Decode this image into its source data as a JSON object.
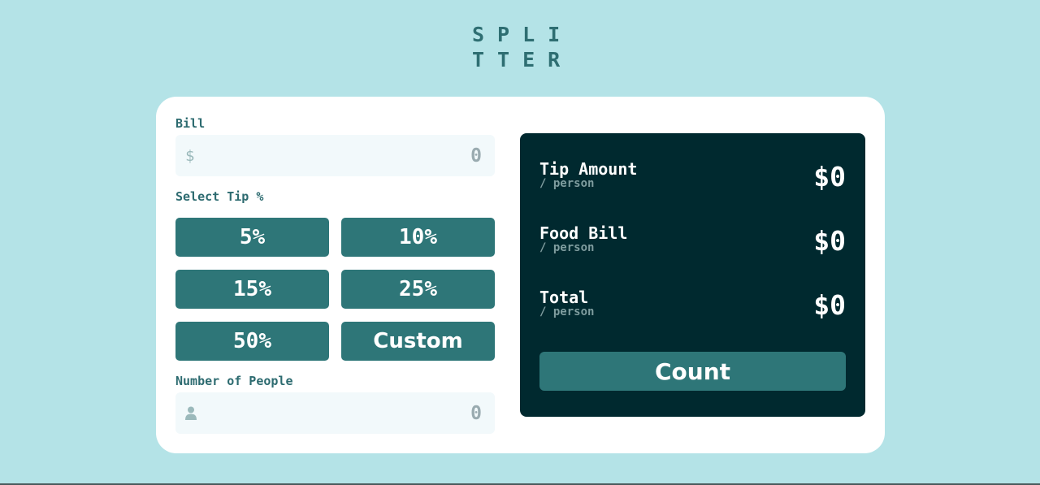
{
  "logo": {
    "line1": "SPLI",
    "line2": "TTER"
  },
  "bill": {
    "label": "Bill",
    "currency_icon": "$",
    "value": "0"
  },
  "tip": {
    "label": "Select Tip %",
    "options": [
      "5%",
      "10%",
      "15%",
      "25%",
      "50%",
      "Custom"
    ]
  },
  "people": {
    "label": "Number of People",
    "icon": "person-icon",
    "value": "0"
  },
  "results": {
    "tip_amount": {
      "name": "Tip Amount",
      "per": "/ person",
      "value": "$0"
    },
    "food_bill": {
      "name": "Food Bill",
      "per": "/ person",
      "value": "$0"
    },
    "total": {
      "name": "Total",
      "per": "/ person",
      "value": "$0"
    },
    "count_label": "Count"
  },
  "colors": {
    "background": "#b4e3e7",
    "accent": "#2e7678",
    "panel": "#00292f",
    "input_bg": "#f2f9fb"
  }
}
